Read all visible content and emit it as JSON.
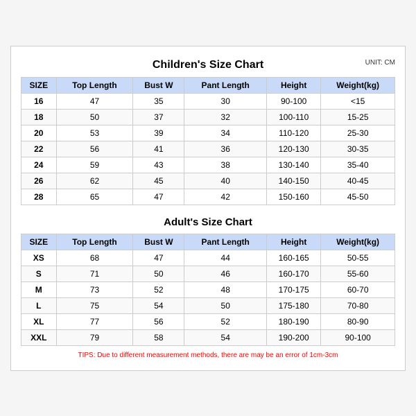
{
  "page": {
    "children_title": "Children's Size Chart",
    "adult_title": "Adult's Size Chart",
    "unit": "UNIT: CM",
    "tips": "TIPS: Due to different measurement methods, there are may be an error of 1cm-3cm",
    "columns": [
      "SIZE",
      "Top Length",
      "Bust W",
      "Pant Length",
      "Height",
      "Weight(kg)"
    ],
    "children_rows": [
      [
        "16",
        "47",
        "35",
        "30",
        "90-100",
        "<15"
      ],
      [
        "18",
        "50",
        "37",
        "32",
        "100-110",
        "15-25"
      ],
      [
        "20",
        "53",
        "39",
        "34",
        "110-120",
        "25-30"
      ],
      [
        "22",
        "56",
        "41",
        "36",
        "120-130",
        "30-35"
      ],
      [
        "24",
        "59",
        "43",
        "38",
        "130-140",
        "35-40"
      ],
      [
        "26",
        "62",
        "45",
        "40",
        "140-150",
        "40-45"
      ],
      [
        "28",
        "65",
        "47",
        "42",
        "150-160",
        "45-50"
      ]
    ],
    "adult_rows": [
      [
        "XS",
        "68",
        "47",
        "44",
        "160-165",
        "50-55"
      ],
      [
        "S",
        "71",
        "50",
        "46",
        "160-170",
        "55-60"
      ],
      [
        "M",
        "73",
        "52",
        "48",
        "170-175",
        "60-70"
      ],
      [
        "L",
        "75",
        "54",
        "50",
        "175-180",
        "70-80"
      ],
      [
        "XL",
        "77",
        "56",
        "52",
        "180-190",
        "80-90"
      ],
      [
        "XXL",
        "79",
        "58",
        "54",
        "190-200",
        "90-100"
      ]
    ]
  }
}
